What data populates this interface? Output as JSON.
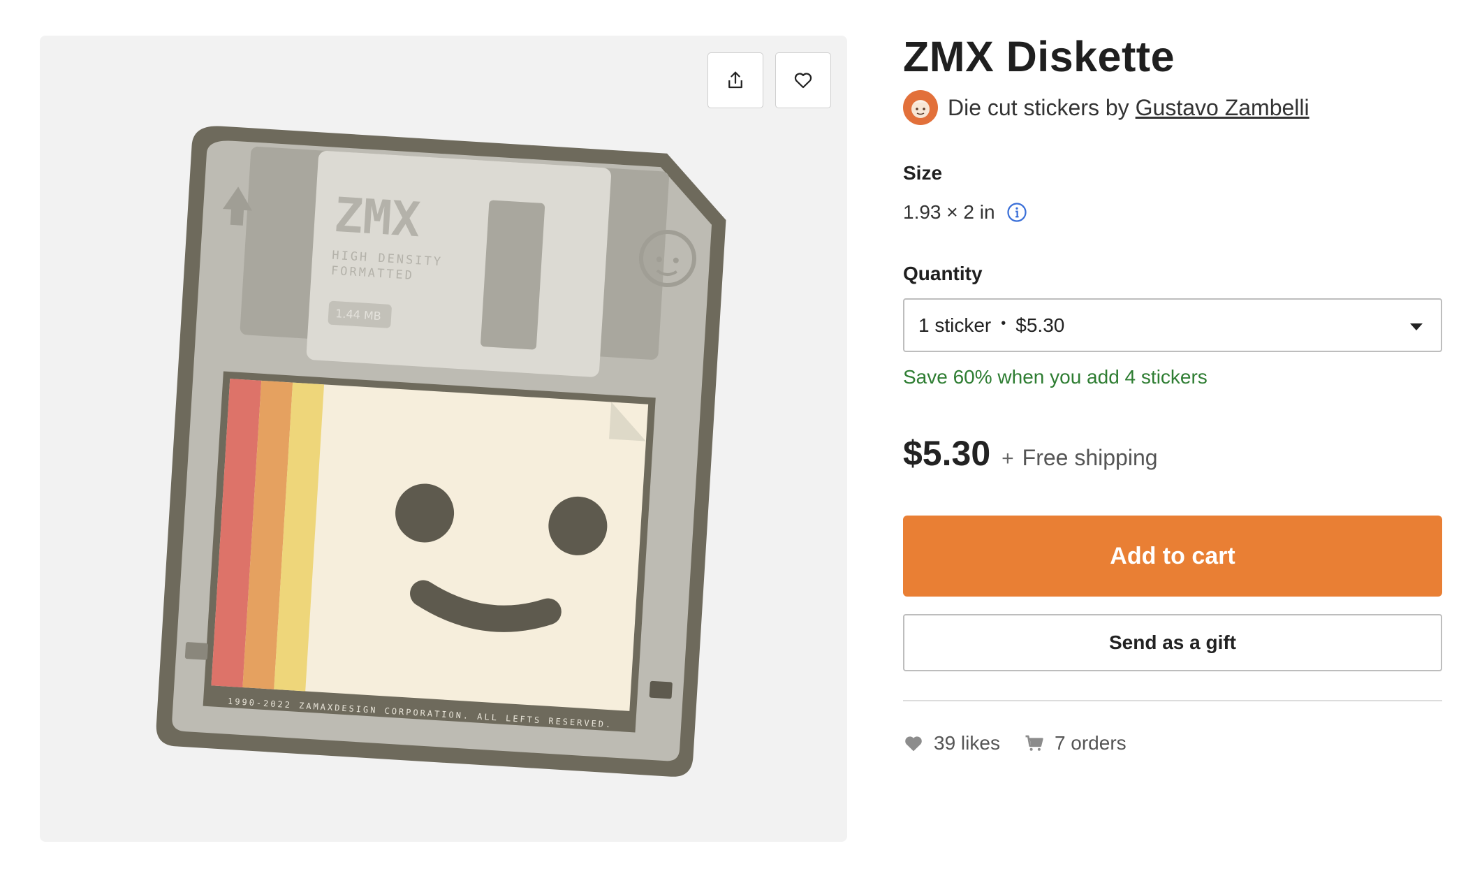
{
  "product": {
    "title": "ZMX Diskette",
    "byline": "Die cut stickers by",
    "artist": "Gustavo Zambelli"
  },
  "image": {
    "alt": "ZMX Diskette sticker",
    "sticker_text": {
      "logo": "ZMX",
      "density_line1": "HIGH DENSITY",
      "density_line2": "FORMATTED",
      "capacity": "1.44 MB",
      "footer": "1990-2022 ZAMAXDESIGN CORPORATION. ALL LEFTS RESERVED."
    },
    "actions": {
      "share_icon": "share-icon",
      "favorite_icon": "heart-icon"
    }
  },
  "size": {
    "label": "Size",
    "value": "1.93 × 2 in",
    "info_icon": "info-icon"
  },
  "quantity": {
    "label": "Quantity",
    "selected_qty": "1 sticker",
    "selected_price": "$5.30",
    "promo": "Save 60% when you add 4 stickers"
  },
  "pricing": {
    "price": "$5.30",
    "plus": "+",
    "shipping": "Free shipping"
  },
  "buttons": {
    "add_to_cart": "Add to cart",
    "gift": "Send as a gift"
  },
  "stats": {
    "likes": "39 likes",
    "orders": "7 orders"
  },
  "colors": {
    "accent": "#e97f34",
    "promo_green": "#2e7d32",
    "info_blue": "#3a6fd8"
  }
}
